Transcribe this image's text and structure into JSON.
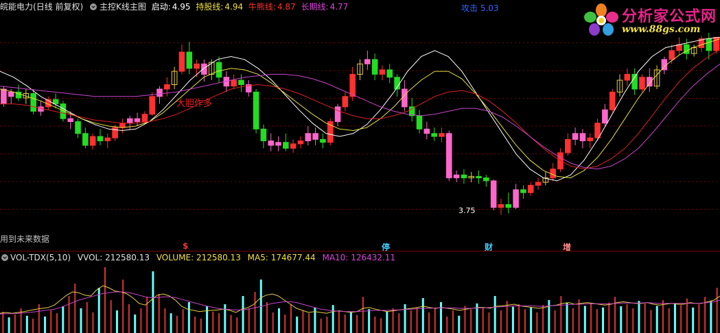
{
  "header": {
    "stock_name": "皖能电力",
    "period": "(日线 前复权)",
    "indicator": "主控K线主图",
    "qidong_label": "启动:",
    "qidong_value": "4.95",
    "chigu_label": "持股线:",
    "chigu_value": "4.94",
    "niuxiong_label": "牛熊线:",
    "niuxiong_value": "4.87",
    "changqi_label": "长期线:",
    "changqi_value": "4.77",
    "gongji_label": "攻击",
    "gongji_value": "5.03"
  },
  "annotations": {
    "dadan": "大胆作多",
    "low_price": "3.75",
    "future_data": "用到未来数据"
  },
  "event_tags": [
    "$",
    "停",
    "财",
    "增"
  ],
  "volume_header": {
    "indicator": "VOL-TDX(5,10)",
    "vvol_label": "VVOL:",
    "vvol_value": "212580.13",
    "volume_label": "VOLUME:",
    "volume_value": "212580.13",
    "ma5_label": "MA5:",
    "ma5_value": "174677.44",
    "ma10_label": "MA10:",
    "ma10_value": "126432.11"
  },
  "logo": {
    "title": "分析家公式网",
    "url": "www.88gs.com"
  },
  "colors": {
    "up_red": "#ff3030",
    "down_green": "#22dd22",
    "pink": "#ff66cc",
    "yellow": "#e8d040",
    "white": "#ffffff",
    "magenta_line": "#cc44cc",
    "red_line": "#dd2222",
    "vol_cyan": "#66ffff",
    "vol_red": "#dd3333",
    "grid": "#7a0000"
  },
  "chart_data": [
    {
      "type": "candlestick",
      "title": "皖能电力 (日线 前复权) 主控K线主图",
      "ylim": [
        3.6,
        5.1
      ],
      "min_label": "3.75",
      "candles": [
        [
          4.6,
          4.62,
          4.5,
          4.48
        ],
        [
          4.55,
          4.6,
          4.58,
          4.5
        ],
        [
          4.58,
          4.63,
          4.54,
          4.52
        ],
        [
          4.54,
          4.6,
          4.57,
          4.5
        ],
        [
          4.57,
          4.6,
          4.45,
          4.43
        ],
        [
          4.45,
          4.52,
          4.48,
          4.42
        ],
        [
          4.48,
          4.55,
          4.53,
          4.46
        ],
        [
          4.53,
          4.57,
          4.5,
          4.47
        ],
        [
          4.5,
          4.52,
          4.4,
          4.38
        ],
        [
          4.4,
          4.45,
          4.38,
          4.33
        ],
        [
          4.38,
          4.4,
          4.3,
          4.27
        ],
        [
          4.3,
          4.34,
          4.22,
          4.2
        ],
        [
          4.22,
          4.3,
          4.28,
          4.19
        ],
        [
          4.28,
          4.33,
          4.25,
          4.22
        ],
        [
          4.25,
          4.3,
          4.27,
          4.2
        ],
        [
          4.27,
          4.36,
          4.34,
          4.25
        ],
        [
          4.34,
          4.4,
          4.37,
          4.3
        ],
        [
          4.37,
          4.42,
          4.4,
          4.33
        ],
        [
          4.4,
          4.44,
          4.38,
          4.35
        ],
        [
          4.38,
          4.45,
          4.43,
          4.36
        ],
        [
          4.43,
          4.58,
          4.55,
          4.42
        ],
        [
          4.55,
          4.62,
          4.6,
          4.5
        ],
        [
          4.6,
          4.68,
          4.63,
          4.55
        ],
        [
          4.63,
          4.75,
          4.72,
          4.6
        ],
        [
          4.72,
          4.9,
          4.85,
          4.7
        ],
        [
          4.85,
          4.92,
          4.74,
          4.7
        ],
        [
          4.74,
          4.8,
          4.77,
          4.68
        ],
        [
          4.77,
          4.8,
          4.7,
          4.65
        ],
        [
          4.7,
          4.8,
          4.78,
          4.66
        ],
        [
          4.78,
          4.82,
          4.68,
          4.64
        ],
        [
          4.68,
          4.72,
          4.62,
          4.58
        ],
        [
          4.62,
          4.7,
          4.66,
          4.6
        ],
        [
          4.66,
          4.7,
          4.63,
          4.58
        ],
        [
          4.63,
          4.66,
          4.58,
          4.55
        ],
        [
          4.58,
          4.6,
          4.33,
          4.3
        ],
        [
          4.33,
          4.36,
          4.25,
          4.2
        ],
        [
          4.25,
          4.3,
          4.22,
          4.18
        ],
        [
          4.22,
          4.28,
          4.24,
          4.18
        ],
        [
          4.24,
          4.3,
          4.2,
          4.18
        ],
        [
          4.2,
          4.26,
          4.23,
          4.17
        ],
        [
          4.23,
          4.28,
          4.25,
          4.2
        ],
        [
          4.25,
          4.35,
          4.3,
          4.22
        ],
        [
          4.3,
          4.34,
          4.26,
          4.22
        ],
        [
          4.26,
          4.3,
          4.24,
          4.2
        ],
        [
          4.24,
          4.4,
          4.38,
          4.22
        ],
        [
          4.38,
          4.5,
          4.48,
          4.35
        ],
        [
          4.48,
          4.58,
          4.55,
          4.45
        ],
        [
          4.55,
          4.75,
          4.7,
          4.52
        ],
        [
          4.7,
          4.8,
          4.77,
          4.66
        ],
        [
          4.77,
          4.86,
          4.8,
          4.73
        ],
        [
          4.8,
          4.84,
          4.7,
          4.66
        ],
        [
          4.7,
          4.76,
          4.73,
          4.66
        ],
        [
          4.73,
          4.77,
          4.68,
          4.64
        ],
        [
          4.68,
          4.7,
          4.6,
          4.55
        ],
        [
          4.6,
          4.66,
          4.48,
          4.45
        ],
        [
          4.48,
          4.54,
          4.42,
          4.38
        ],
        [
          4.42,
          4.46,
          4.33,
          4.3
        ],
        [
          4.33,
          4.38,
          4.3,
          4.26
        ],
        [
          4.3,
          4.34,
          4.28,
          4.25
        ],
        [
          4.28,
          4.34,
          4.3,
          4.24
        ],
        [
          4.3,
          4.32,
          4.0,
          3.98
        ],
        [
          4.0,
          4.05,
          4.02,
          3.97
        ],
        [
          4.02,
          4.06,
          4.0,
          3.96
        ],
        [
          4.0,
          4.04,
          4.01,
          3.97
        ],
        [
          4.01,
          4.05,
          4.0,
          3.96
        ],
        [
          4.0,
          4.02,
          3.98,
          3.94
        ],
        [
          3.98,
          3.99,
          3.8,
          3.78
        ],
        [
          3.8,
          3.86,
          3.82,
          3.75
        ],
        [
          3.82,
          3.9,
          3.8,
          3.76
        ],
        [
          3.8,
          3.96,
          3.92,
          3.79
        ],
        [
          3.92,
          3.95,
          3.9,
          3.86
        ],
        [
          3.9,
          3.97,
          3.95,
          3.88
        ],
        [
          3.95,
          4.0,
          3.97,
          3.92
        ],
        [
          3.97,
          4.04,
          4.0,
          3.95
        ],
        [
          4.0,
          4.1,
          4.06,
          3.98
        ],
        [
          4.06,
          4.2,
          4.17,
          4.04
        ],
        [
          4.17,
          4.3,
          4.26,
          4.15
        ],
        [
          4.26,
          4.34,
          4.3,
          4.22
        ],
        [
          4.3,
          4.33,
          4.25,
          4.2
        ],
        [
          4.25,
          4.3,
          4.27,
          4.2
        ],
        [
          4.27,
          4.4,
          4.37,
          4.25
        ],
        [
          4.37,
          4.5,
          4.46,
          4.35
        ],
        [
          4.46,
          4.6,
          4.58,
          4.44
        ],
        [
          4.58,
          4.7,
          4.66,
          4.55
        ],
        [
          4.66,
          4.74,
          4.7,
          4.62
        ],
        [
          4.7,
          4.74,
          4.6,
          4.56
        ],
        [
          4.6,
          4.7,
          4.68,
          4.58
        ],
        [
          4.68,
          4.74,
          4.62,
          4.58
        ],
        [
          4.62,
          4.76,
          4.73,
          4.6
        ],
        [
          4.73,
          4.82,
          4.8,
          4.7
        ],
        [
          4.8,
          4.9,
          4.86,
          4.77
        ],
        [
          4.86,
          4.95,
          4.9,
          4.83
        ],
        [
          4.9,
          4.94,
          4.84,
          4.8
        ],
        [
          4.84,
          4.9,
          4.88,
          4.82
        ],
        [
          4.88,
          4.96,
          4.94,
          4.85
        ],
        [
          4.94,
          4.98,
          4.86,
          4.8
        ],
        [
          4.86,
          4.92,
          4.95,
          4.84
        ]
      ],
      "series": [
        {
          "name": "启动",
          "color": "#ffffff",
          "values": [
            4.72,
            4.68,
            4.62,
            4.55,
            4.5,
            4.45,
            4.4,
            4.36,
            4.33,
            4.32,
            4.33,
            4.38,
            4.46,
            4.56,
            4.66,
            4.74,
            4.8,
            4.82,
            4.8,
            4.74,
            4.66,
            4.56,
            4.46,
            4.37,
            4.3,
            4.28,
            4.3,
            4.36,
            4.46,
            4.58,
            4.72,
            4.82,
            4.86,
            4.82,
            4.72,
            4.58,
            4.44,
            4.3,
            4.16,
            4.06,
            4.0,
            3.98,
            4.02,
            4.12,
            4.26,
            4.42,
            4.58,
            4.72,
            4.82,
            4.88,
            4.9,
            4.92,
            4.94,
            4.95
          ]
        },
        {
          "name": "持股线",
          "color": "#e8e040",
          "values": [
            4.6,
            4.58,
            4.55,
            4.52,
            4.48,
            4.44,
            4.4,
            4.37,
            4.35,
            4.34,
            4.35,
            4.38,
            4.44,
            4.52,
            4.6,
            4.68,
            4.72,
            4.74,
            4.73,
            4.7,
            4.64,
            4.57,
            4.5,
            4.43,
            4.37,
            4.33,
            4.32,
            4.34,
            4.4,
            4.48,
            4.58,
            4.66,
            4.72,
            4.72,
            4.67,
            4.57,
            4.46,
            4.34,
            4.22,
            4.12,
            4.05,
            4.01,
            4.0,
            4.05,
            4.14,
            4.26,
            4.4,
            4.54,
            4.66,
            4.76,
            4.83,
            4.88,
            4.91,
            4.94
          ]
        },
        {
          "name": "牛熊线",
          "color": "#dd2222",
          "values": [
            4.5,
            4.5,
            4.49,
            4.47,
            4.45,
            4.43,
            4.41,
            4.39,
            4.38,
            4.37,
            4.37,
            4.38,
            4.4,
            4.43,
            4.47,
            4.52,
            4.56,
            4.6,
            4.62,
            4.63,
            4.62,
            4.6,
            4.57,
            4.53,
            4.49,
            4.45,
            4.42,
            4.4,
            4.4,
            4.42,
            4.45,
            4.5,
            4.55,
            4.58,
            4.59,
            4.57,
            4.52,
            4.45,
            4.37,
            4.28,
            4.2,
            4.13,
            4.08,
            4.06,
            4.08,
            4.13,
            4.2,
            4.3,
            4.42,
            4.54,
            4.65,
            4.74,
            4.81,
            4.87
          ]
        },
        {
          "name": "长期线",
          "color": "#cc44cc",
          "values": [
            4.62,
            4.61,
            4.6,
            4.59,
            4.58,
            4.57,
            4.56,
            4.55,
            4.55,
            4.55,
            4.55,
            4.56,
            4.57,
            4.58,
            4.6,
            4.62,
            4.64,
            4.66,
            4.68,
            4.69,
            4.7,
            4.7,
            4.69,
            4.67,
            4.64,
            4.6,
            4.56,
            4.52,
            4.48,
            4.45,
            4.43,
            4.42,
            4.43,
            4.45,
            4.47,
            4.47,
            4.45,
            4.41,
            4.35,
            4.28,
            4.21,
            4.15,
            4.1,
            4.07,
            4.06,
            4.08,
            4.13,
            4.2,
            4.3,
            4.41,
            4.52,
            4.62,
            4.7,
            4.77
          ]
        }
      ]
    },
    {
      "type": "bar",
      "title": "VOL-TDX(5,10)",
      "volumes": [
        52,
        38,
        45,
        60,
        42,
        35,
        70,
        40,
        55,
        48,
        65,
        90,
        120,
        60,
        75,
        50,
        110,
        160,
        80,
        55,
        130,
        70,
        45,
        60,
        88,
        150,
        95,
        60,
        48,
        42,
        58,
        75,
        40,
        35,
        65,
        52,
        48,
        70,
        44,
        38,
        90,
        60,
        100,
        130,
        75,
        50,
        60,
        45,
        70,
        40,
        55,
        48,
        62,
        35,
        40,
        68,
        55,
        45,
        52,
        44,
        88,
        58,
        40,
        36,
        52,
        60,
        48,
        70,
        55,
        62,
        85,
        50,
        60,
        75,
        40,
        55,
        42,
        66,
        58,
        72,
        60,
        50,
        90,
        55,
        78,
        64,
        70,
        58,
        62,
        50,
        68,
        80,
        55,
        90,
        74,
        60,
        82,
        66,
        70,
        58,
        62,
        74,
        88,
        65,
        70,
        60,
        78,
        72,
        56,
        66,
        80,
        60,
        72,
        68,
        84,
        62,
        70,
        88,
        78,
        110
      ],
      "ma5": [
        48,
        50,
        48,
        50,
        52,
        55,
        58,
        60,
        62,
        68,
        80,
        92,
        100,
        98,
        92,
        90,
        105,
        115,
        110,
        102,
        100,
        95,
        85,
        72,
        68,
        80,
        92,
        95,
        90,
        80,
        65,
        58,
        55,
        52,
        54,
        55,
        56,
        58,
        55,
        50,
        58,
        62,
        70,
        85,
        92,
        95,
        90,
        80,
        70,
        60,
        55,
        50,
        52,
        50,
        48,
        52,
        54,
        52,
        50,
        52,
        60,
        62,
        58,
        55,
        52,
        54,
        56,
        58,
        60,
        62,
        65,
        62,
        60,
        62,
        60,
        58,
        55,
        58,
        60,
        62,
        62,
        60,
        65,
        66,
        68,
        70,
        66,
        64,
        62,
        60,
        62,
        66,
        68,
        72,
        74,
        70,
        72,
        74,
        72,
        70,
        68,
        70,
        74,
        76,
        74,
        72,
        72,
        74,
        70,
        68,
        70,
        72,
        70,
        70,
        74,
        72,
        72,
        76,
        80,
        90
      ],
      "ma10": [
        46,
        47,
        47,
        48,
        49,
        50,
        52,
        54,
        56,
        58,
        62,
        68,
        74,
        80,
        84,
        88,
        92,
        96,
        98,
        100,
        100,
        99,
        96,
        92,
        88,
        86,
        86,
        88,
        88,
        86,
        82,
        78,
        74,
        70,
        66,
        63,
        60,
        58,
        57,
        56,
        56,
        58,
        61,
        64,
        68,
        72,
        74,
        76,
        76,
        74,
        70,
        66,
        62,
        58,
        56,
        54,
        53,
        52,
        52,
        52,
        53,
        54,
        55,
        55,
        55,
        56,
        56,
        57,
        58,
        59,
        60,
        60,
        61,
        61,
        61,
        61,
        60,
        60,
        60,
        61,
        61,
        62,
        63,
        64,
        65,
        66,
        66,
        66,
        66,
        65,
        65,
        66,
        67,
        68,
        69,
        70,
        70,
        71,
        71,
        71,
        71,
        71,
        72,
        73,
        73,
        73,
        73,
        74,
        73,
        72,
        72,
        72,
        72,
        72,
        72,
        72,
        73,
        74,
        76,
        80
      ]
    }
  ]
}
